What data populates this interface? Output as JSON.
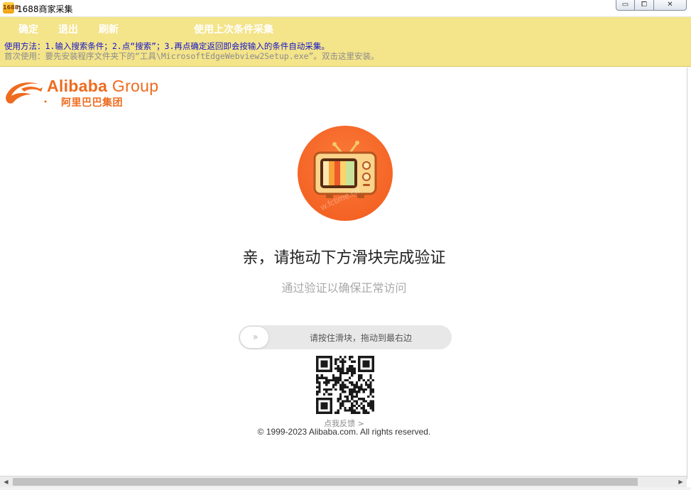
{
  "window": {
    "icon_text": "1688",
    "title": "1688商家采集",
    "controls": {
      "minimize": "▭",
      "maximize": "⧠",
      "close": "✕"
    }
  },
  "toolbar": {
    "confirm_label": "确定",
    "exit_label": "退出",
    "refresh_label": "刷新",
    "reuse_label": "使用上次条件采集",
    "usage_line": "使用方法：1.输入搜索条件；2.点“搜索”；3.再点确定返回即会按输入的条件自动采集。",
    "first_use_line": "首次使用：要先安装程序文件夹下的“工具\\MicrosoftEdgeWebview2Setup.exe”。双击这里安装。",
    "colors": {
      "background": "#f4e48a",
      "usage_text": "#1414c8",
      "hint_text": "#8c8c8c"
    }
  },
  "page": {
    "logo": {
      "en_main": "Alibaba",
      "en_group": "Group",
      "cn": "阿里巴巴集团",
      "color": "#ef6b1f"
    },
    "tv_icon": "retro-tv-icon",
    "watermark": "w.fctime.cn",
    "verify_title": "亲，请拖动下方滑块完成验证",
    "verify_subtitle": "通过验证以确保正常访问",
    "slider": {
      "handle_glyph": "»",
      "hint": "请按住滑块，拖动到最右边",
      "progress": 0
    },
    "qr_code": "qr-code",
    "feedback_link": "点我反馈 >",
    "copyright": "© 1999-2023 Alibaba.com. All rights reserved.",
    "accent_color": "#f15a1c"
  },
  "scrollbar": {
    "left_arrow": "◀",
    "right_arrow": "▶"
  }
}
